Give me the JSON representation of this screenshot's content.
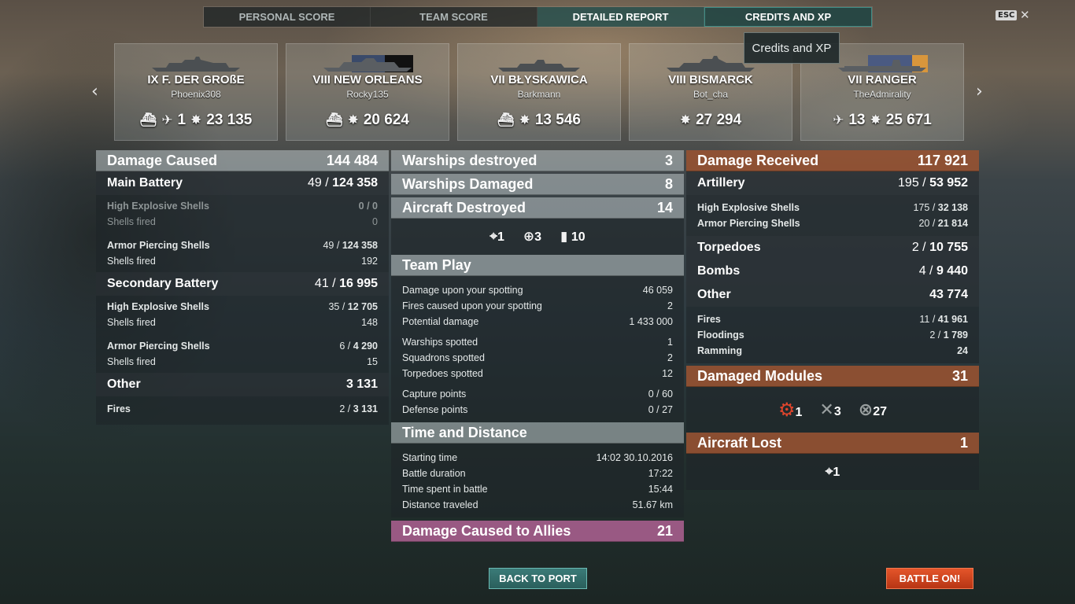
{
  "tabs": [
    {
      "label": "PERSONAL SCORE"
    },
    {
      "label": "TEAM SCORE"
    },
    {
      "label": "DETAILED REPORT"
    },
    {
      "label": "CREDITS AND XP"
    }
  ],
  "esc_label": "ESC",
  "tooltip": "Credits and XP",
  "ships": [
    {
      "name": "IX F. DER GROßE",
      "player": "Phoenix308",
      "planes": "1",
      "damage": "23 135"
    },
    {
      "name": "VIII NEW ORLEANS",
      "player": "Rocky135",
      "damage": "20 624"
    },
    {
      "name": "VII BŁYSKAWICA",
      "player": "Barkmann",
      "damage": "13 546"
    },
    {
      "name": "VIII BISMARCK",
      "player": "Bot_cha",
      "damage": "27 294"
    },
    {
      "name": "VII RANGER",
      "player": "TheAdmirality",
      "planes": "13",
      "damage": "25 671"
    }
  ],
  "caused": {
    "title": "Damage Caused",
    "total": "144 484",
    "main": {
      "label": "Main Battery",
      "hits": "49",
      "dmg": "124 358"
    },
    "main_he": {
      "label": "High Explosive Shells",
      "value": "0 / 0"
    },
    "main_he_fired": {
      "label": "Shells fired",
      "value": "0"
    },
    "main_ap": {
      "label": "Armor Piercing Shells",
      "hits": "49",
      "dmg": "124 358"
    },
    "main_ap_fired": {
      "label": "Shells fired",
      "value": "192"
    },
    "sec": {
      "label": "Secondary Battery",
      "hits": "41",
      "dmg": "16 995"
    },
    "sec_he": {
      "label": "High Explosive Shells",
      "hits": "35",
      "dmg": "12 705"
    },
    "sec_he_fired": {
      "label": "Shells fired",
      "value": "148"
    },
    "sec_ap": {
      "label": "Armor Piercing Shells",
      "hits": "6",
      "dmg": "4 290"
    },
    "sec_ap_fired": {
      "label": "Shells fired",
      "value": "15"
    },
    "other": {
      "label": "Other",
      "value": "3 131"
    },
    "fires": {
      "label": "Fires",
      "hits": "2",
      "dmg": "3 131"
    }
  },
  "mid": {
    "destroyed": {
      "label": "Warships destroyed",
      "value": "3"
    },
    "damaged": {
      "label": "Warships Damaged",
      "value": "8"
    },
    "aircraft": {
      "label": "Aircraft Destroyed",
      "value": "14"
    },
    "aircraft_icons": {
      "fighters": "1",
      "bombers": "3",
      "torp": "10"
    },
    "team": {
      "title": "Team Play",
      "rows": [
        {
          "label": "Damage upon your spotting",
          "value": "46 059"
        },
        {
          "label": "Fires caused upon your spotting",
          "value": "2"
        },
        {
          "label": "Potential damage",
          "value": "1 433 000"
        },
        {
          "label": "Warships spotted",
          "value": "1"
        },
        {
          "label": "Squadrons spotted",
          "value": "2"
        },
        {
          "label": "Torpedoes spotted",
          "value": "12"
        },
        {
          "label": "Capture points",
          "value": "0 / 60"
        },
        {
          "label": "Defense points",
          "value": "0 / 27"
        }
      ]
    },
    "time": {
      "title": "Time and Distance",
      "rows": [
        {
          "label": "Starting time",
          "value": "14:02  30.10.2016"
        },
        {
          "label": "Battle duration",
          "value": "17:22"
        },
        {
          "label": "Time spent in battle",
          "value": "15:44"
        },
        {
          "label": "Distance traveled",
          "value": "51.67 km"
        }
      ]
    },
    "allies": {
      "label": "Damage Caused to Allies",
      "value": "21"
    }
  },
  "received": {
    "title": "Damage Received",
    "total": "117 921",
    "artillery": {
      "label": "Artillery",
      "hits": "195",
      "dmg": "53 952"
    },
    "he": {
      "label": "High Explosive Shells",
      "hits": "175",
      "dmg": "32 138"
    },
    "ap": {
      "label": "Armor Piercing Shells",
      "hits": "20",
      "dmg": "21 814"
    },
    "torp": {
      "label": "Torpedoes",
      "hits": "2",
      "dmg": "10 755"
    },
    "bombs": {
      "label": "Bombs",
      "hits": "4",
      "dmg": "9 440"
    },
    "other": {
      "label": "Other",
      "value": "43 774"
    },
    "fires": {
      "label": "Fires",
      "hits": "11",
      "dmg": "41 961"
    },
    "flood": {
      "label": "Floodings",
      "hits": "2",
      "dmg": "1 789"
    },
    "ram": {
      "label": "Ramming",
      "value": "24"
    },
    "modules": {
      "label": "Damaged Modules",
      "value": "31",
      "icons": {
        "a": "1",
        "b": "3",
        "c": "27"
      }
    },
    "lost": {
      "label": "Aircraft Lost",
      "value": "1",
      "icon": "1"
    }
  },
  "buttons": {
    "port": "BACK TO PORT",
    "battle": "BATTLE ON!"
  }
}
